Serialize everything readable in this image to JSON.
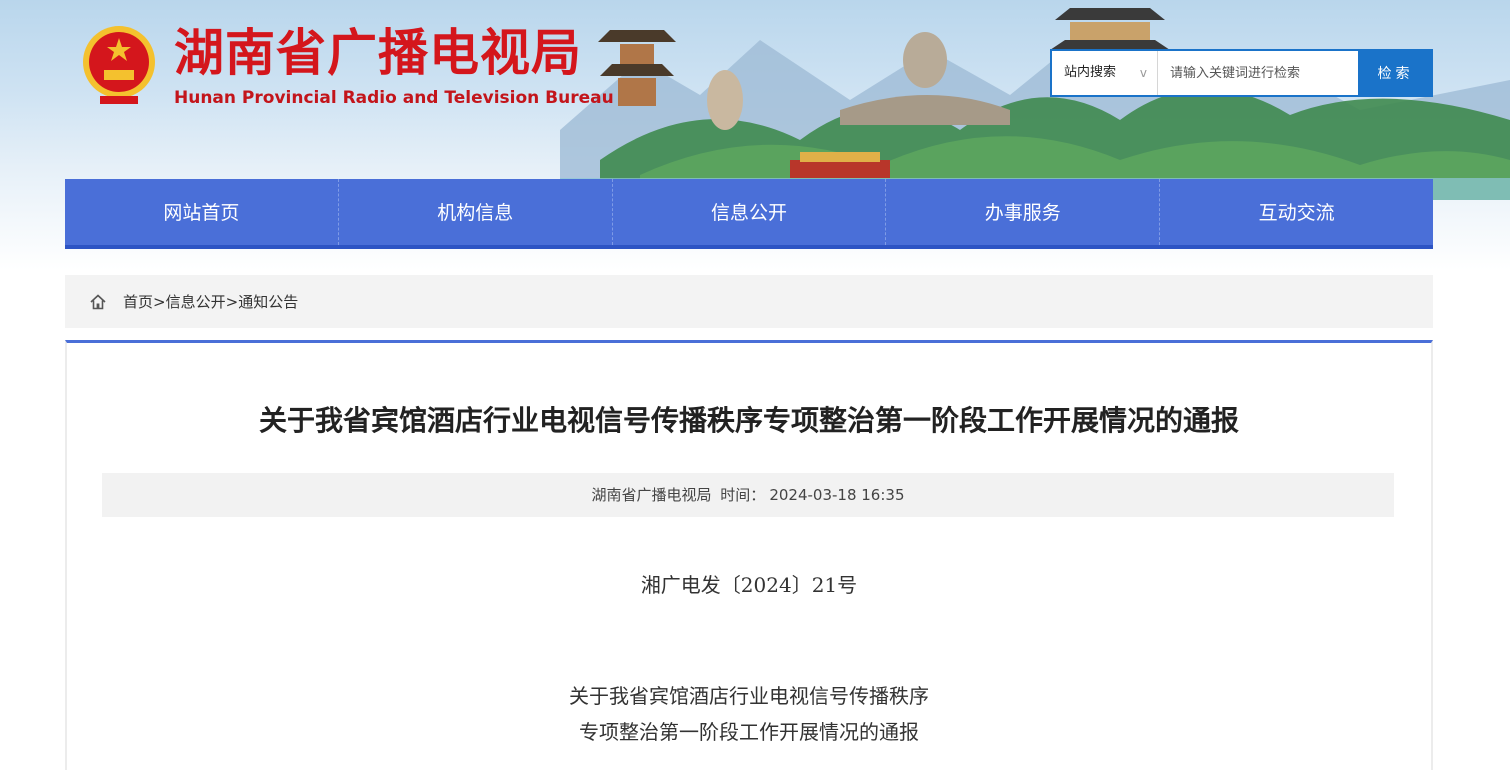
{
  "header": {
    "title_cn": "湖南省广播电视局",
    "title_en": "Hunan Provincial Radio and Television Bureau",
    "emblem": "national-emblem",
    "brand_red": "#d4161c"
  },
  "search": {
    "scope_label": "站内搜索",
    "scope_chevron": "v",
    "placeholder": "请输入关键词进行检索",
    "button_label": "检索",
    "accent": "#1a73c9"
  },
  "nav": {
    "items": [
      {
        "label": "网站首页"
      },
      {
        "label": "机构信息"
      },
      {
        "label": "信息公开"
      },
      {
        "label": "办事服务"
      },
      {
        "label": "互动交流"
      }
    ],
    "color": "#4a6fd8"
  },
  "breadcrumb": {
    "icon": "home-icon",
    "items": [
      "首页",
      "信息公开",
      "通知公告"
    ],
    "separator": ">"
  },
  "article": {
    "title": "关于我省宾馆酒店行业电视信号传播秩序专项整治第一阶段工作开展情况的通报",
    "source": "湖南省广播电视局",
    "time_label": "时间：",
    "time": "2024-03-18 16:35",
    "doc_number": "湘广电发〔2024〕21号",
    "subtitle_line1": "关于我省宾馆酒店行业电视信号传播秩序",
    "subtitle_line2": "专项整治第一阶段工作开展情况的通报"
  }
}
